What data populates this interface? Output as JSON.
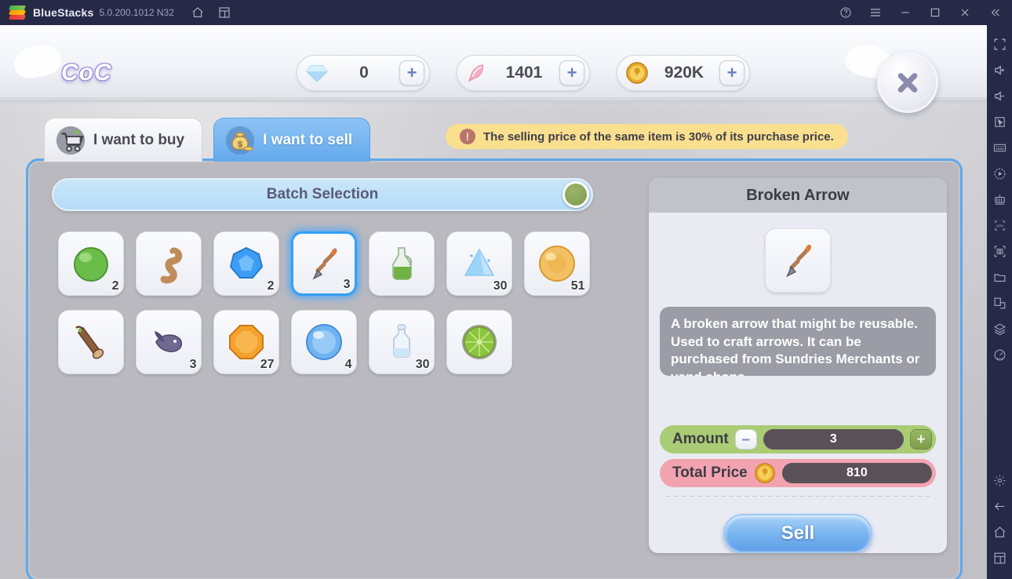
{
  "titlebar": {
    "app_name": "BlueStacks",
    "version": "5.0.200.1012 N32",
    "icons": [
      "bluestacks-logo",
      "home-icon",
      "multi-instance-icon"
    ],
    "controls": [
      "help-icon",
      "menu-icon",
      "minimize-icon",
      "maximize-icon",
      "close-icon",
      "collapse-icon"
    ]
  },
  "game": {
    "logo": "CoC",
    "close_label": "×",
    "currencies": [
      {
        "name": "diamond",
        "value": "0",
        "plus": "+"
      },
      {
        "name": "feather",
        "value": "1401",
        "plus": "+"
      },
      {
        "name": "gold-coin",
        "value": "920K",
        "plus": "+"
      }
    ],
    "tabs": [
      {
        "id": "buy",
        "label": "I want to buy",
        "icon": "shopping-cart-icon",
        "active": false
      },
      {
        "id": "sell",
        "label": "I want to sell",
        "icon": "money-bag-icon",
        "active": true
      }
    ],
    "notice": {
      "icon": "exclamation-icon",
      "text": "The selling price of the same item is 30% of its purchase price."
    },
    "batch": {
      "label": "Batch Selection",
      "toggle_state": "off"
    },
    "inventory": [
      {
        "name": "green-sphere",
        "qty": "2",
        "selected": false
      },
      {
        "name": "brown-worm",
        "qty": "",
        "selected": false
      },
      {
        "name": "blue-gem",
        "qty": "2",
        "selected": false
      },
      {
        "name": "broken-arrow",
        "qty": "3",
        "selected": true
      },
      {
        "name": "green-potion-flask",
        "qty": "",
        "selected": false
      },
      {
        "name": "blue-crystal-pile",
        "qty": "30",
        "selected": false
      },
      {
        "name": "orange-sphere",
        "qty": "51",
        "selected": false
      },
      {
        "name": "wood-log",
        "qty": "",
        "selected": false
      },
      {
        "name": "purple-fish",
        "qty": "3",
        "selected": false
      },
      {
        "name": "orange-gem",
        "qty": "27",
        "selected": false
      },
      {
        "name": "blue-orb",
        "qty": "4",
        "selected": false
      },
      {
        "name": "glass-bottle",
        "qty": "30",
        "selected": false
      },
      {
        "name": "green-lime",
        "qty": "",
        "selected": false
      }
    ],
    "detail": {
      "title": "Broken Arrow",
      "icon": "broken-arrow-icon",
      "description": "A broken arrow that might be reusable. Used to craft arrows. It can be purchased from Sundries Merchants or vend shops.",
      "amount_label": "Amount",
      "amount_value": "3",
      "minus_label": "–",
      "plus_label": "+",
      "price_label": "Total Price",
      "price_value": "810",
      "price_icon": "gold-coin-icon",
      "sell_label": "Sell"
    }
  },
  "sidebar": {
    "items": [
      "fullscreen-icon",
      "volume-up-icon",
      "volume-down-icon",
      "cursor-icon",
      "keyboard-icon",
      "record-icon",
      "game-controls-icon",
      "apk-install-icon",
      "screenshot-icon",
      "folder-icon",
      "multi-instance-icon",
      "layers-icon",
      "performance-icon"
    ],
    "bottom_items": [
      "settings-icon",
      "back-icon",
      "home-icon",
      "recents-icon"
    ]
  }
}
